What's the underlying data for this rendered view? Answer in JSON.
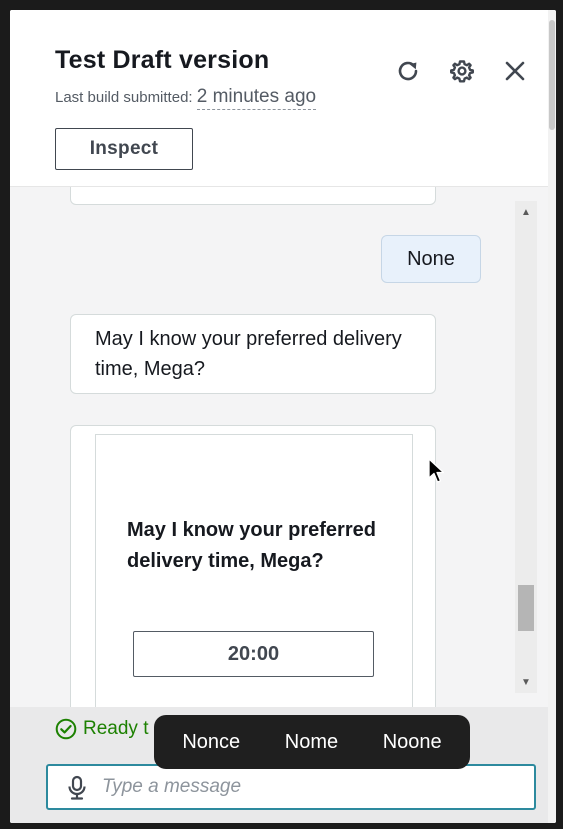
{
  "header": {
    "title": "Test Draft version",
    "subtitle_prefix": "Last build submitted:",
    "subtitle_time": "2 minutes ago",
    "inspect_label": "Inspect",
    "icons": [
      "refresh-icon",
      "settings-icon",
      "close-icon"
    ]
  },
  "conversation": {
    "messages": [
      {
        "role": "user",
        "text": "None"
      },
      {
        "role": "bot",
        "text": "May I know your preferred delivery time, Mega?"
      }
    ],
    "card": {
      "title": "May I know your preferred delivery time, Mega?",
      "button_label": "20:00"
    }
  },
  "footer": {
    "status_text": "Ready t",
    "status_color": "#1d8102",
    "input_placeholder": "Type a message"
  },
  "suggestions": [
    "Nonce",
    "Nome",
    "Noone"
  ],
  "colors": {
    "accent": "#2d8a9e",
    "user_bubble": "#e8f1fb",
    "suggest_bg": "#1f1f1f"
  }
}
